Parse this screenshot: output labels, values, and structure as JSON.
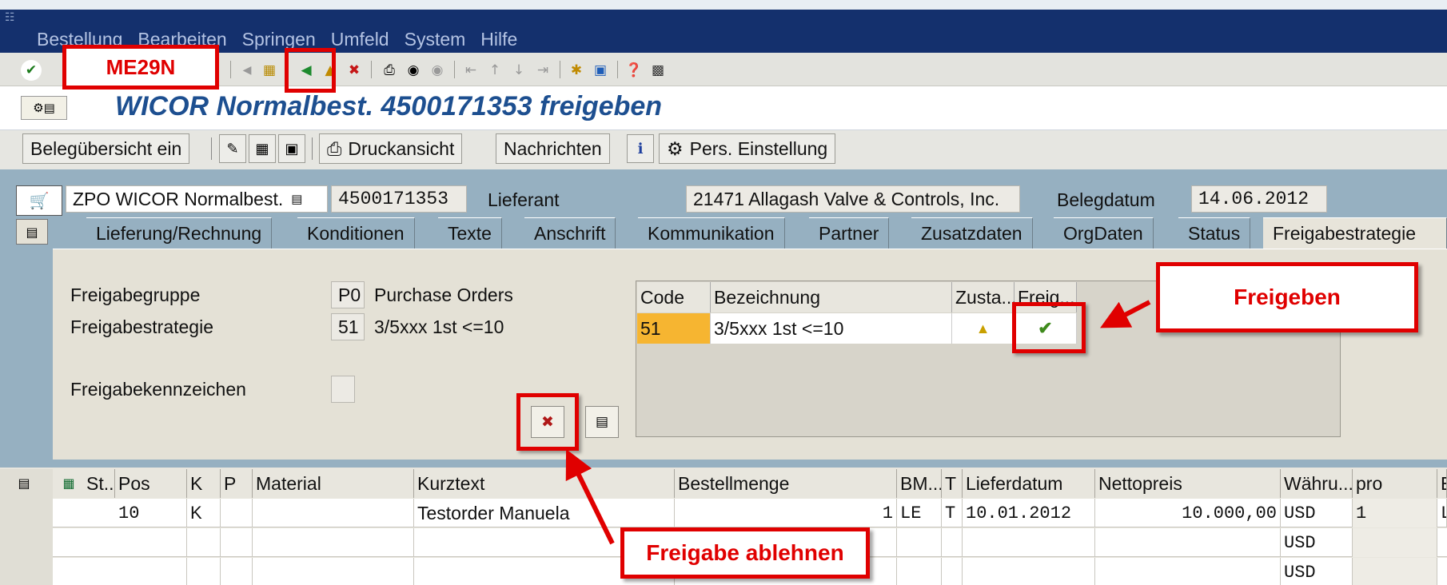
{
  "menu": [
    "Bestellung",
    "Bearbeiten",
    "Springen",
    "Umfeld",
    "System",
    "Hilfe"
  ],
  "transaction_code": "ME29N",
  "page_title": "WICOR Normalbest. 4500171353 freigeben",
  "app_toolbar": {
    "doc_overview": "Belegübersicht ein",
    "print_preview": "Druckansicht",
    "messages": "Nachrichten",
    "personal_setting": "Pers. Einstellung"
  },
  "header": {
    "doc_type": "ZPO WICOR Normalbest.",
    "po_number": "4500171353",
    "vendor_label": "Lieferant",
    "vendor": "21471 Allagash Valve & Controls, Inc.",
    "doc_date_label": "Belegdatum",
    "doc_date": "14.06.2012"
  },
  "tabs": [
    "Lieferung/Rechnung",
    "Konditionen",
    "Texte",
    "Anschrift",
    "Kommunikation",
    "Partner",
    "Zusatzdaten",
    "OrgDaten",
    "Status",
    "Freigabestrategie"
  ],
  "release": {
    "group_label": "Freigabegruppe",
    "group_code": "P0",
    "group_text": "Purchase Orders",
    "strategy_label": "Freigabestrategie",
    "strategy_code": "51",
    "strategy_text": "3/5xxx 1st <=10",
    "indicator_label": "Freigabekennzeichen",
    "grid_headers": [
      "Code",
      "Bezeichnung",
      "Zusta...",
      "Freig..."
    ],
    "grid_row": {
      "code": "51",
      "text": "3/5xxx 1st <=10",
      "status_icon": "warning-triangle-icon",
      "release_icon": "release-check-icon"
    }
  },
  "items": {
    "headers": [
      "St...",
      "Pos",
      "K",
      "P",
      "Material",
      "Kurztext",
      "Bestellmenge",
      "BM...",
      "T",
      "Lieferdatum",
      "Nettopreis",
      "Währu...",
      "pro",
      "E"
    ],
    "rows": [
      {
        "pos": "10",
        "k": "K",
        "kurztext": "Testorder Manuela",
        "menge": "1",
        "bm": "LE",
        "t": "T",
        "datum": "10.01.2012",
        "preis": "10.000,00",
        "waehrung": "USD",
        "pro": "1",
        "e": "L"
      },
      {
        "waehrung": "USD"
      },
      {
        "waehrung": "USD"
      }
    ]
  },
  "annotations": {
    "release_label": "Freigeben",
    "reject_label": "Freigabe ablehnen"
  },
  "colors": {
    "title_bar": "#14306d",
    "title_text": "#1d4f90",
    "workarea": "#96b0c1",
    "annotation": "#e00000"
  }
}
